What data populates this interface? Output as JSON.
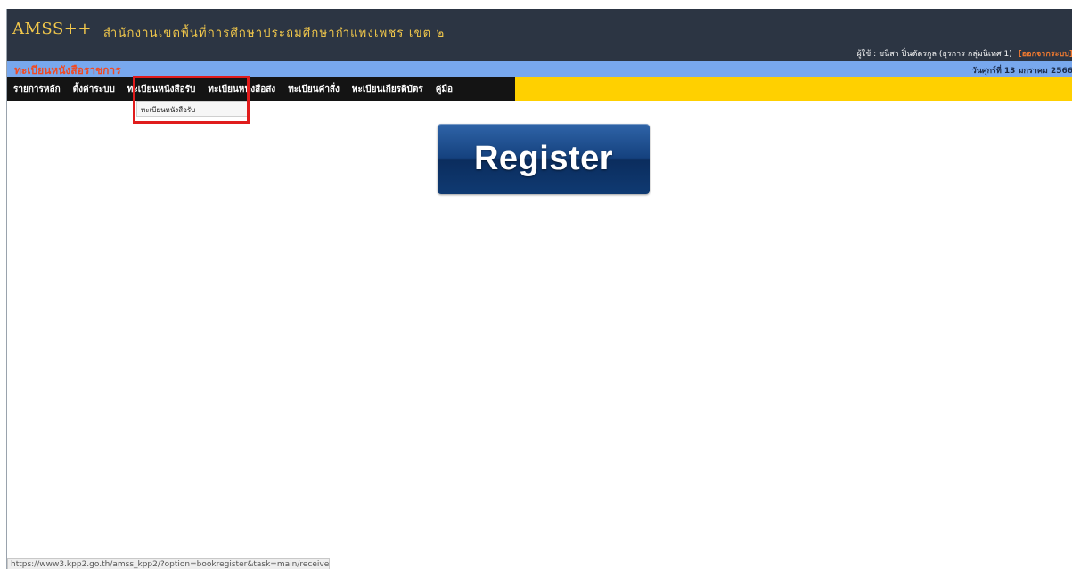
{
  "header": {
    "brand": "AMSS++",
    "org_name": "สำนักงานเขตพื้นที่การศึกษาประถมศึกษากำแพงเพชร เขต ๒",
    "user_info": "ผู้ใช้ : ชนิสา ปิ่นตัตรกูล (ธุรการ กลุ่มนิเทศ 1)",
    "logout_label": "[ออกจากระบบ]"
  },
  "bluebar": {
    "section_title": "ทะเบียนหนังสือราชการ",
    "date": "วันศุกร์ที่ 13 มกราคม 2566"
  },
  "nav": {
    "items": [
      {
        "label": "รายการหลัก"
      },
      {
        "label": "ตั้งค่าระบบ"
      },
      {
        "label": "ทะเบียนหนังสือรับ"
      },
      {
        "label": "ทะเบียนหนังสือส่ง"
      },
      {
        "label": "ทะเบียนคำสั่ง"
      },
      {
        "label": "ทะเบียนเกียรติบัตร"
      },
      {
        "label": "คู่มือ"
      }
    ],
    "active_index": 2
  },
  "dropdown": {
    "items": [
      {
        "label": "ทะเบียนหนังสือรับ"
      }
    ]
  },
  "register_button": {
    "label": "Register"
  },
  "status": {
    "url": "https://www3.kpp2.go.th/amss_kpp2/?option=bookregister&task=main/receive"
  },
  "colors": {
    "header_bg": "#2c3543",
    "brand_text": "#f2c84b",
    "bluebar_bg": "#78a8ee",
    "section_title": "#f24a22",
    "nav_black": "#141414",
    "nav_yellow": "#ffd000",
    "highlight": "#e01c1c",
    "register_button": "#15427f"
  }
}
